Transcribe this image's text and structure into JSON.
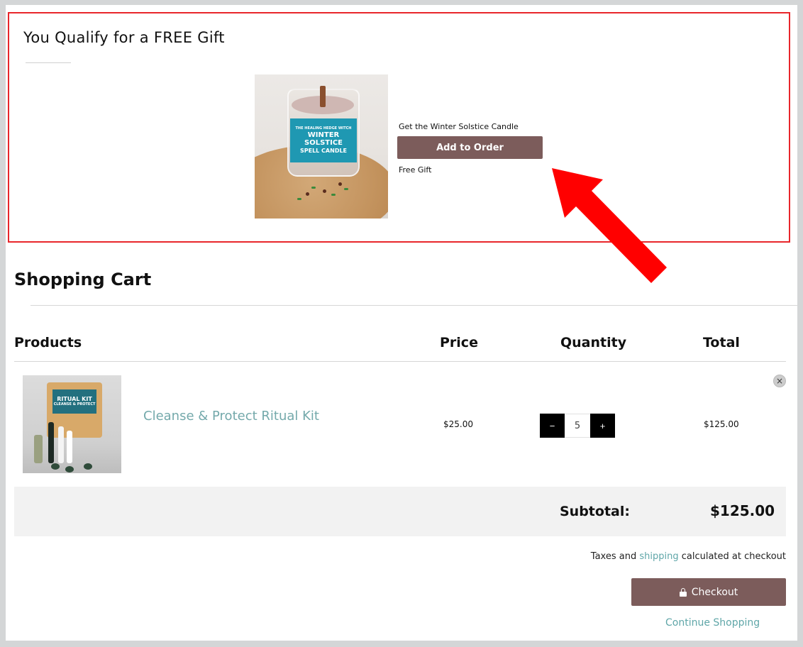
{
  "gift": {
    "title": "You Qualify for a FREE Gift",
    "caption": "Get the Winter Solstice Candle",
    "button_label": "Add to Order",
    "subtext": "Free Gift",
    "image": {
      "label_line1": "THE HEALING HEDGE WITCH",
      "label_line2": "WINTER SOLSTICE",
      "label_line3": "SPELL CANDLE"
    }
  },
  "cart": {
    "title": "Shopping Cart",
    "headers": {
      "products": "Products",
      "price": "Price",
      "quantity": "Quantity",
      "total": "Total"
    },
    "items": [
      {
        "name": "Cleanse & Protect Ritual Kit",
        "price": "$25.00",
        "quantity": "5",
        "total": "$125.00",
        "image_label_line1": "RITUAL KIT",
        "image_label_line2": "CLEANSE & PROTECT"
      }
    ],
    "qty_minus": "−",
    "qty_plus": "+",
    "remove_icon": "×",
    "subtotal_label": "Subtotal:",
    "subtotal_value": "$125.00",
    "taxes_before": "Taxes and",
    "taxes_link": "shipping",
    "taxes_after": "calculated at checkout",
    "checkout_label": "Checkout",
    "continue_label": "Continue Shopping"
  },
  "colors": {
    "highlight_border": "#e8262b",
    "arrow": "#ff0000",
    "button_bg": "#7c5c5b",
    "link": "#5fa6a8",
    "product_link": "#74a9ab"
  },
  "icons": {
    "lock": "lock-icon",
    "remove": "close-icon",
    "annotation_arrow": "arrow-icon"
  }
}
